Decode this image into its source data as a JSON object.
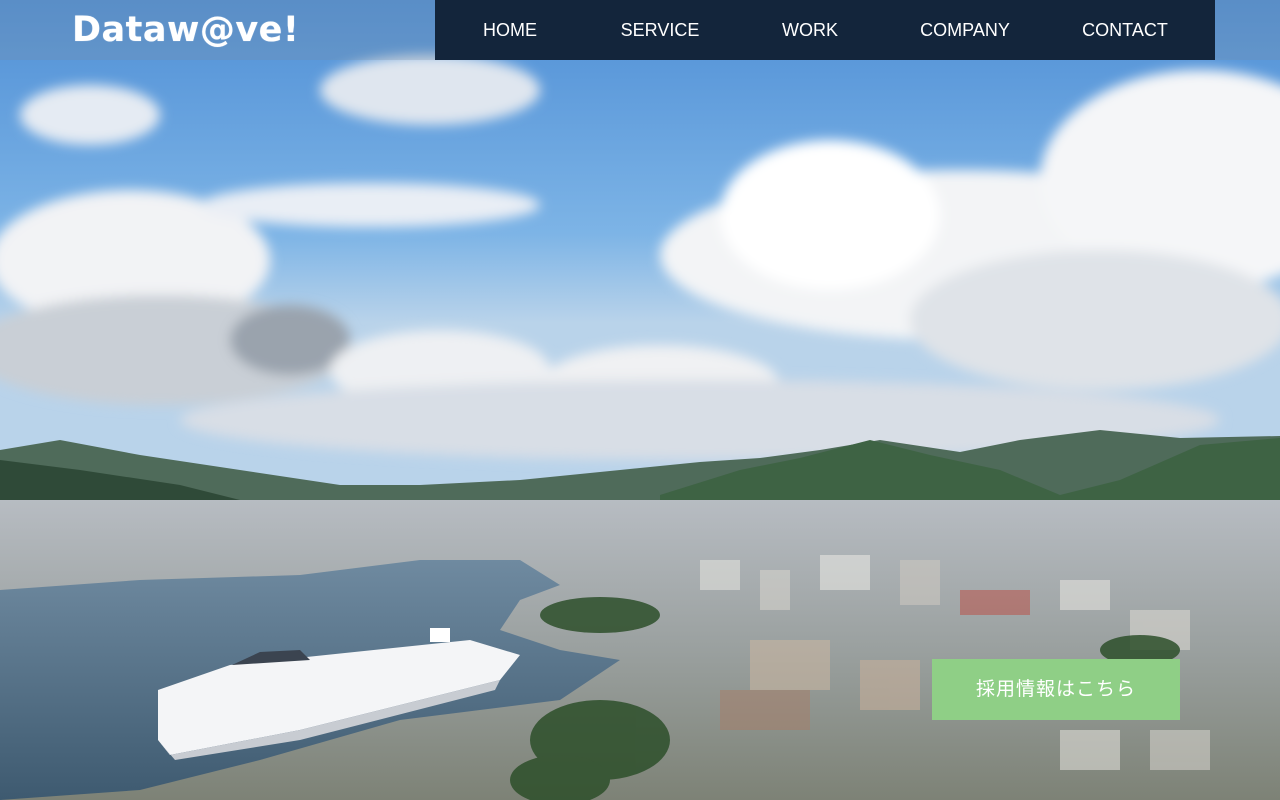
{
  "header": {
    "logo_text": "Dataw@ve!"
  },
  "nav": {
    "items": [
      {
        "label": "HOME"
      },
      {
        "label": "SERVICE"
      },
      {
        "label": "WORK"
      },
      {
        "label": "COMPANY"
      },
      {
        "label": "CONTACT"
      }
    ]
  },
  "hero": {
    "recruit_button_label": "採用情報はこちら"
  },
  "colors": {
    "nav_background": "#13253b",
    "recruit_button": "#8fcf86",
    "sky": "#6fa6de"
  }
}
